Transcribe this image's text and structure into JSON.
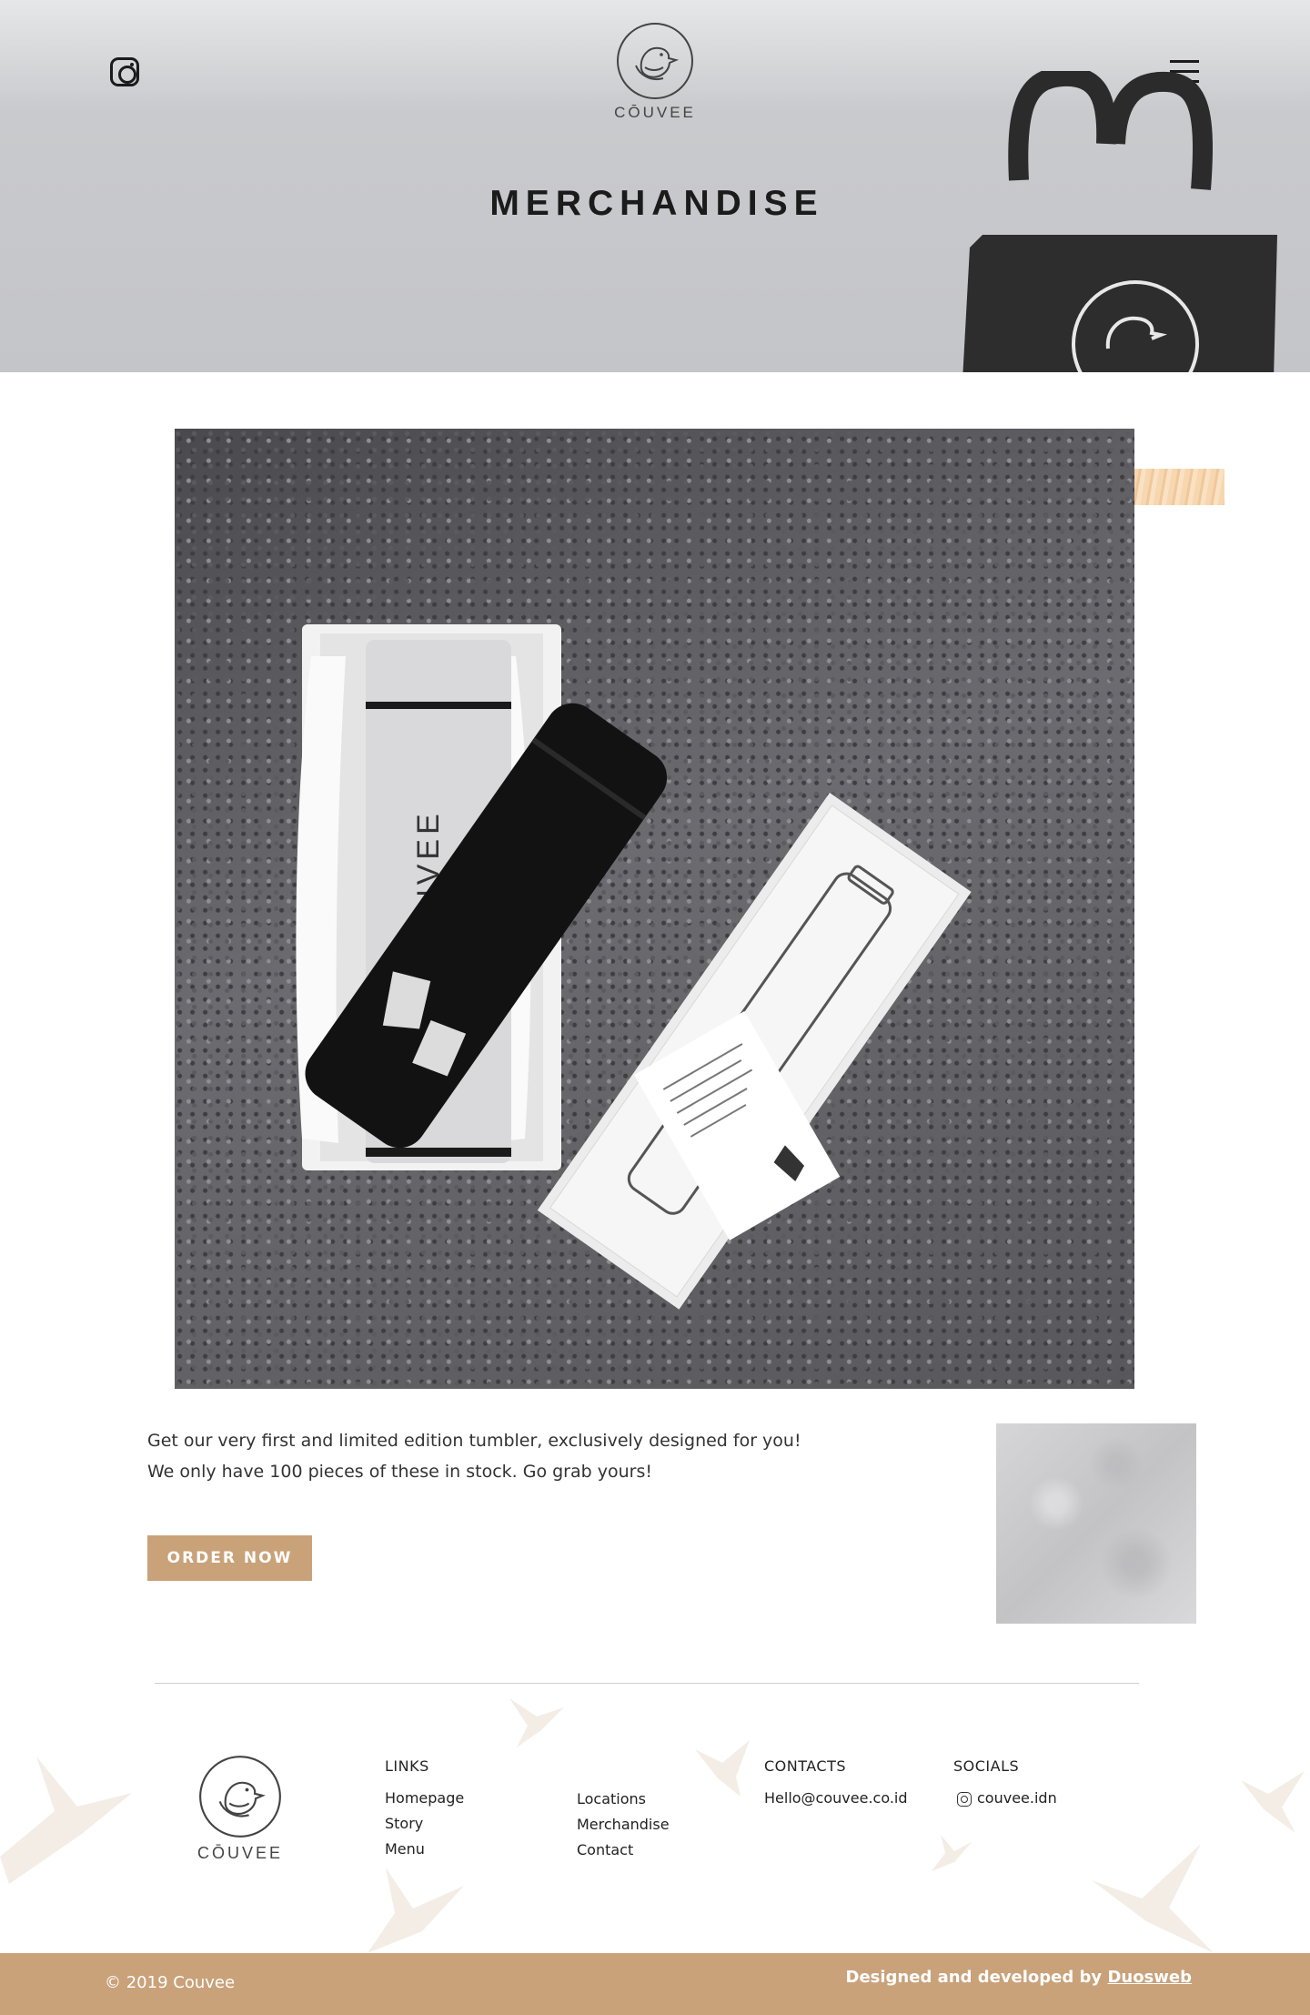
{
  "header": {
    "brand": "CŌUVEE",
    "title": "MERCHANDISE"
  },
  "product": {
    "tumbler_brand": "CŌUVEE",
    "description_line1": "Get our very first and limited edition tumbler, exclusively designed for you!",
    "description_line2": "We only have 100 pieces of these in stock. Go grab yours!",
    "order_label": "ORDER NOW"
  },
  "footer": {
    "brand": "CŌUVEE",
    "links_title": "LINKS",
    "links_col1": [
      "Homepage",
      "Story",
      "Menu"
    ],
    "links_col2": [
      "Locations",
      "Merchandise",
      "Contact"
    ],
    "contacts_title": "CONTACTS",
    "email": "Hello@couvee.co.id",
    "socials_title": "SOCIALS",
    "instagram_handle": "couvee.idn",
    "copyright": "© 2019 Couvee",
    "credit_prefix": "Designed and developed by",
    "credit_link": "Duosweb"
  },
  "colors": {
    "accent": "#c9a27a",
    "hero_bg": "#c4c5c9",
    "text": "#222222"
  }
}
